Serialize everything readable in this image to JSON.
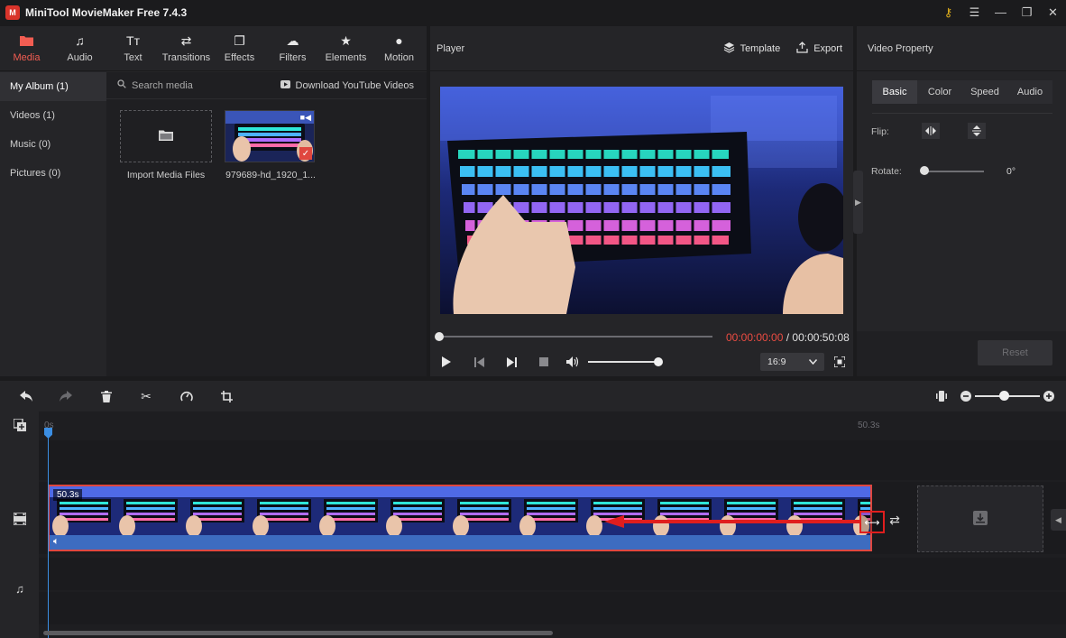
{
  "app": {
    "title": "MiniTool MovieMaker Free 7.4.3",
    "logo_letter": "M"
  },
  "window_controls": {
    "key_icon": "key-icon",
    "menu_icon": "hamburger-menu-icon",
    "minimize": "—",
    "maximize": "❐",
    "close": "✕"
  },
  "media_tabs": [
    {
      "label": "Media",
      "icon": "folder-icon",
      "glyph": "▬"
    },
    {
      "label": "Audio",
      "icon": "music-note-icon",
      "glyph": "♫"
    },
    {
      "label": "Text",
      "icon": "text-icon",
      "glyph": "Tт"
    },
    {
      "label": "Transitions",
      "icon": "swap-arrows-icon",
      "glyph": "⇄"
    },
    {
      "label": "Effects",
      "icon": "effects-icon",
      "glyph": "❐"
    },
    {
      "label": "Filters",
      "icon": "filters-icon",
      "glyph": "☁"
    },
    {
      "label": "Elements",
      "icon": "elements-icon",
      "glyph": "★"
    },
    {
      "label": "Motion",
      "icon": "motion-icon",
      "glyph": "●"
    }
  ],
  "side_nav": [
    {
      "label": "My Album (1)"
    },
    {
      "label": "Videos (1)"
    },
    {
      "label": "Music (0)"
    },
    {
      "label": "Pictures (0)"
    }
  ],
  "media_toolbar": {
    "search_placeholder": "Search media",
    "download_label": "Download YouTube Videos"
  },
  "media_items": {
    "import_label": "Import Media Files",
    "clip_label": "979689-hd_1920_1..."
  },
  "player": {
    "title": "Player",
    "template_label": "Template",
    "export_label": "Export",
    "current_time": "00:00:00:00",
    "separator": " / ",
    "total_time": "00:00:50:08",
    "aspect_ratio": "16:9",
    "progress": 0,
    "volume": 1.0
  },
  "property": {
    "title": "Video Property",
    "tabs": [
      "Basic",
      "Color",
      "Speed",
      "Audio"
    ],
    "flip_label": "Flip:",
    "rotate_label": "Rotate:",
    "rotate_value": "0°",
    "reset_label": "Reset"
  },
  "timeline": {
    "ruler_start": "0s",
    "ruler_end": "50.3s",
    "clip_duration": "50.3s",
    "zoom_level": 0.45
  },
  "colors": {
    "accent": "#f25d52",
    "playhead": "#3b8ee3",
    "time_current": "#ec4c42",
    "clip_border": "#e0473f",
    "trim_highlight": "#e01e1e"
  }
}
